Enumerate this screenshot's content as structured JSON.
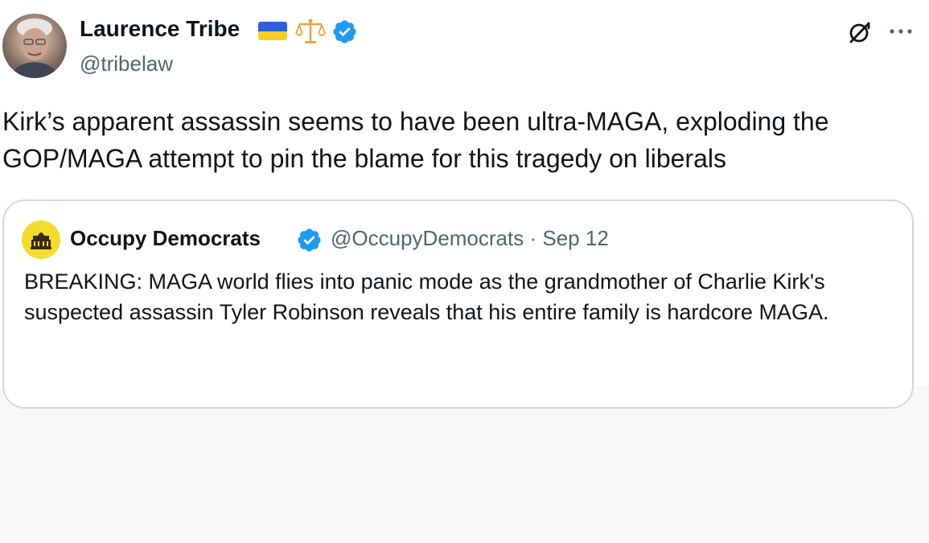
{
  "tweet": {
    "author": {
      "name": "Laurence Tribe",
      "handle": "@tribelaw",
      "badges": [
        "flag-ukraine-icon",
        "balance-scale-icon",
        "verified-badge-icon"
      ]
    },
    "text": "Kirk’s apparent assassin seems to have been ultra-MAGA, exploding the GOP/MAGA attempt to pin the blame for this tragedy on liberals",
    "actions": [
      "grok-icon",
      "more-options-icon"
    ]
  },
  "quote": {
    "author": {
      "name": "Occupy Democrats",
      "handle": "@OccupyDemocrats",
      "separator": "·",
      "date": "Sep 12"
    },
    "text": "BREAKING: MAGA world flies into panic mode as the grandmother of Charlie Kirk's suspected assassin Tyler Robinson reveals that his entire family is hardcore MAGA."
  },
  "colors": {
    "text_primary": "#0f1419",
    "text_secondary": "#536471",
    "verified_blue": "#1d9bf0",
    "card_border": "#cfd9de",
    "occupy_yellow": "#f4dd2a"
  }
}
